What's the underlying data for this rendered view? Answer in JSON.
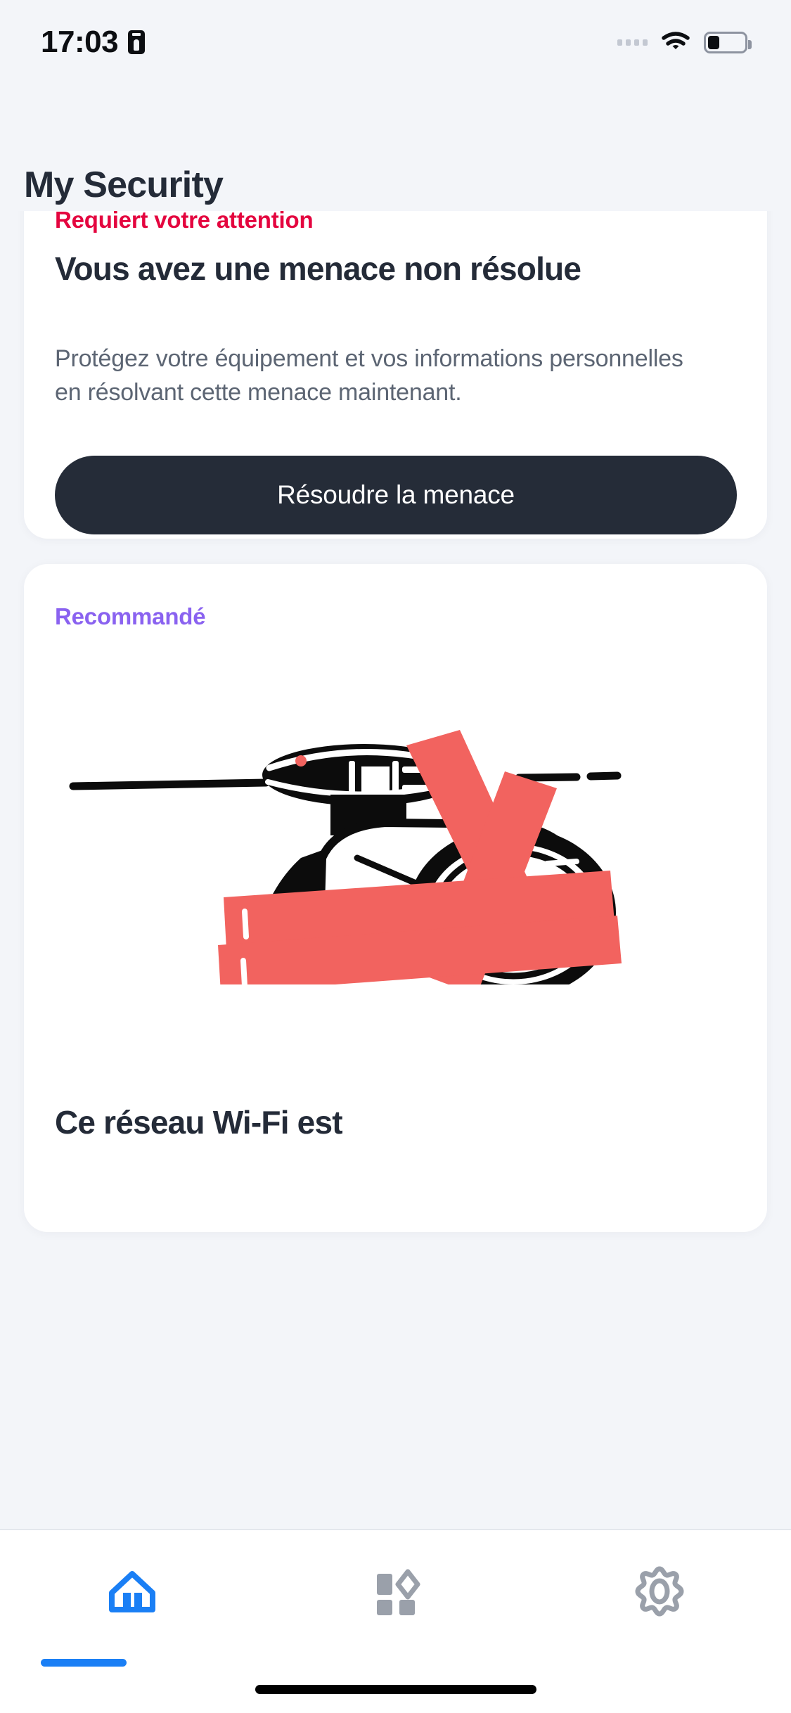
{
  "status_bar": {
    "time": "17:03",
    "id_icon": "id-card-icon",
    "signal_icon": "signal-dots-icon",
    "wifi_icon": "wifi-icon",
    "battery_icon": "battery-low-icon"
  },
  "page": {
    "title": "My Security"
  },
  "cards": {
    "threat": {
      "eyebrow": "Requiert votre attention",
      "eyebrow_color": "#e4053f",
      "headline": "Vous avez une menace non résolue",
      "body": "Protégez votre équipement et vos informations personnelles en résolvant cette menace maintenant.",
      "cta_label": "Résoudre la menace",
      "cta_bg": "#252c38",
      "cta_text_color": "#ffffff"
    },
    "recommended": {
      "eyebrow": "Recommandé",
      "eyebrow_color": "#8a62f0",
      "illustration": "disabled-security-camera-illustration",
      "title": "Ce réseau Wi-Fi est"
    }
  },
  "tabbar": {
    "items": [
      {
        "icon": "home-icon",
        "active": true
      },
      {
        "icon": "apps-grid-icon",
        "active": false
      },
      {
        "icon": "gear-icon",
        "active": false
      }
    ],
    "active_color": "#1a7ff5",
    "inactive_color": "#9aa0aa"
  },
  "theme": {
    "background": "#f3f5f9",
    "card_background": "#ffffff",
    "text_primary": "#242b38",
    "text_secondary": "#5c6573",
    "accent_red": "#e4053f",
    "accent_purple": "#8a62f0",
    "illustration_red": "#f2635f"
  }
}
